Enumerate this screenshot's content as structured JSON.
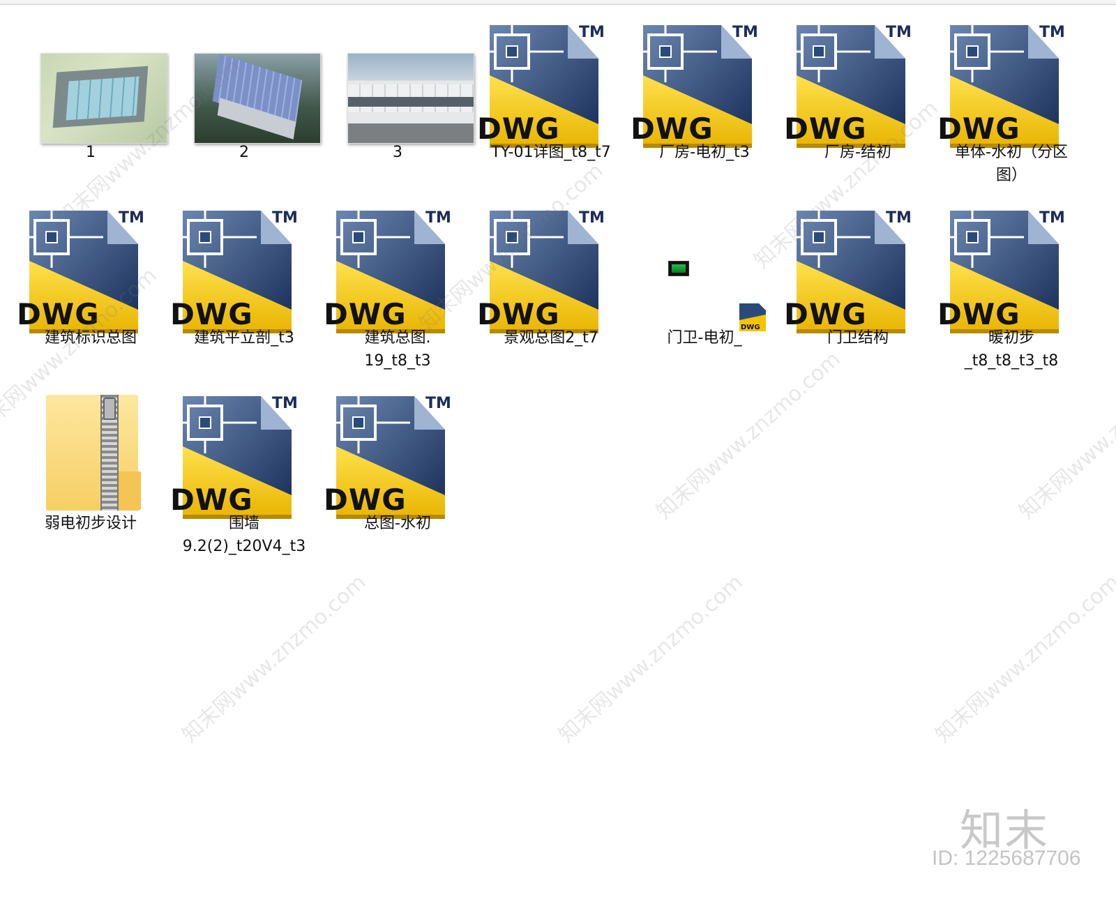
{
  "files": [
    {
      "name": "1",
      "type": "image-thumbnail",
      "icon": "site-plan-thumbnail"
    },
    {
      "name": "2",
      "type": "image-thumbnail",
      "icon": "aerial-render-thumbnail"
    },
    {
      "name": "3",
      "type": "image-thumbnail",
      "icon": "facade-render-thumbnail"
    },
    {
      "name": "TY-01详图_t8_t7",
      "type": "dwg",
      "icon": "dwg-file-icon"
    },
    {
      "name": "厂房-电初_t3",
      "type": "dwg",
      "icon": "dwg-file-icon"
    },
    {
      "name": "厂房-结初",
      "type": "dwg",
      "icon": "dwg-file-icon"
    },
    {
      "name": "单体-水初（分区\n图）",
      "type": "dwg",
      "icon": "dwg-file-icon"
    },
    {
      "name": "建筑标识总图",
      "type": "dwg",
      "icon": "dwg-file-icon"
    },
    {
      "name": "建筑平立剖_t3",
      "type": "dwg",
      "icon": "dwg-file-icon"
    },
    {
      "name": "建筑总图.\n19_t8_t3",
      "type": "dwg",
      "icon": "dwg-file-icon"
    },
    {
      "name": "景观总图2_t7",
      "type": "dwg",
      "icon": "dwg-file-icon"
    },
    {
      "name": "门卫-电初_",
      "type": "dwg-small",
      "icon": "video-file-icon"
    },
    {
      "name": "门卫结构",
      "type": "dwg",
      "icon": "dwg-file-icon"
    },
    {
      "name": "暖初步\n_t8_t8_t3_t8",
      "type": "dwg",
      "icon": "dwg-file-icon"
    },
    {
      "name": "弱电初步设计",
      "type": "zip",
      "icon": "zip-folder-icon"
    },
    {
      "name": "围墙\n9.2(2)_t20V4_t3",
      "type": "dwg",
      "icon": "dwg-file-icon"
    },
    {
      "name": "总图-水初",
      "type": "dwg",
      "icon": "dwg-file-icon"
    }
  ],
  "dwg_badge": {
    "text": "DWG",
    "tm": "TM"
  },
  "watermark": {
    "text": "知末网www.znzmo.com",
    "brand": "知末",
    "id": "ID: 1225687706"
  },
  "colors": {
    "dwg_yellow": "#f5c400",
    "dwg_blue": "#1d3563",
    "background": "#ffffff"
  }
}
